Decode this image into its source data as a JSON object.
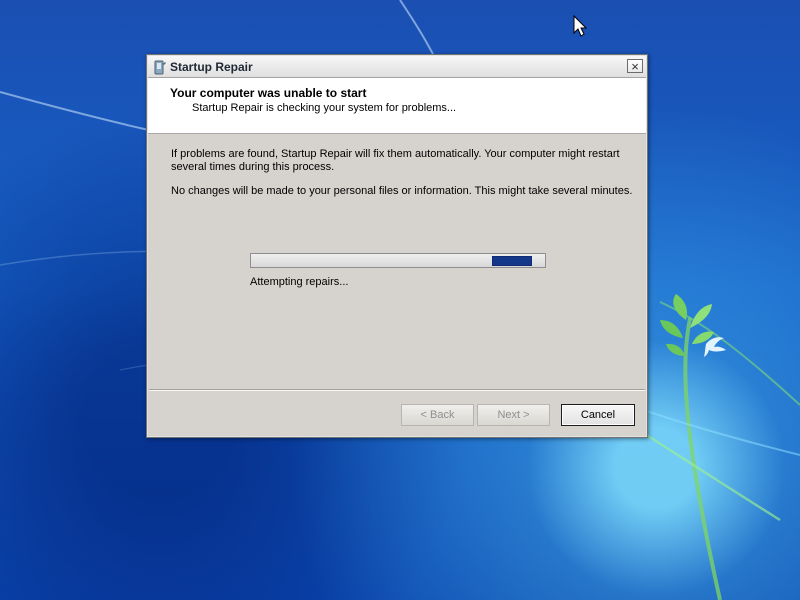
{
  "window": {
    "title": "Startup Repair"
  },
  "header": {
    "heading": "Your computer was unable to start",
    "subheading": "Startup Repair is checking your system for problems..."
  },
  "content": {
    "line1": "If problems are found, Startup Repair will fix them automatically. Your computer might restart several times during this process.",
    "line2": "No changes will be made to your personal files or information. This might take several minutes."
  },
  "progress": {
    "status": "Attempting repairs...",
    "fill_start_fraction": 0.82,
    "fill_fraction": 0.135,
    "color": "#13388a"
  },
  "buttons": {
    "back_label": "< Back",
    "next_label": "Next >",
    "cancel_label": "Cancel"
  },
  "icons": {
    "app": "startup-repair-icon",
    "close": "close-icon",
    "cursor": "cursor-arrow-icon",
    "wallpaper": "windows-bird-branch-wallpaper"
  },
  "colors": {
    "desktop_blue": "#1561c8",
    "dialog_gray": "#d6d3ce",
    "header_white": "#ffffff"
  }
}
